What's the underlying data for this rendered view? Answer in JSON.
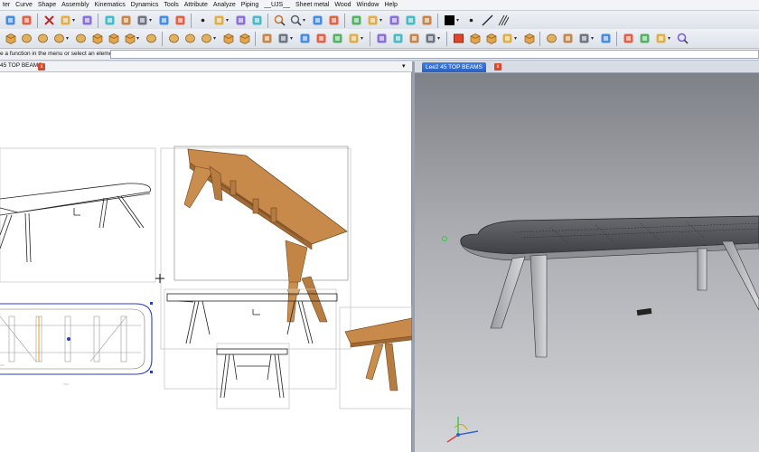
{
  "menu": [
    "ter",
    "Curve",
    "Shape",
    "Assembly",
    "Kinematics",
    "Dynamics",
    "Tools",
    "Attribute",
    "Analyze",
    "Piping",
    "__UJS__",
    "Sheet metal",
    "Wood",
    "Window",
    "Help"
  ],
  "toolbar1": {
    "icons": [
      "layers-icon",
      "print-icon",
      "delete-icon",
      "undo-icon",
      "eraser-icon",
      "refresh-icon",
      "copy-icon",
      "move-icon",
      "align-icon",
      "grid-icon",
      "pointer-icon",
      "cross-arrows-icon",
      "scissors-icon",
      "pencil-icon",
      "zoom-in-icon",
      "zoom-window-icon",
      "fit-icon",
      "pan-icon",
      "rotate-icon",
      "view-icon",
      "shade-icon",
      "render-icon",
      "light-icon",
      "color-swatch-icon",
      "point-icon",
      "line-style-icon",
      "hatch-icon"
    ]
  },
  "toolbar2": {
    "icons": [
      "box-icon",
      "cylinder-icon",
      "cone-icon",
      "sphere-icon",
      "torus-icon",
      "wedge-icon",
      "prism-icon",
      "extrude-icon",
      "revolve-icon",
      "sweep-icon",
      "loft-icon",
      "fillet-icon",
      "chamfer-icon",
      "shell-icon",
      "union-icon",
      "subtract-icon",
      "intersect-icon",
      "split-icon",
      "mirror-icon",
      "pattern-icon",
      "offset-icon",
      "draft-icon",
      "thicken-icon",
      "boolean-icon",
      "solid-red-icon",
      "solid-cube-icon",
      "sheet-icon",
      "wood-joint-icon",
      "board-icon",
      "dowel-icon",
      "view-plane-icon",
      "measure-icon",
      "section-icon",
      "assembly-icon",
      "bom-icon",
      "hand-icon",
      "info-icon"
    ]
  },
  "prompt": {
    "text": "e a function in the menu or select an element:",
    "value": ""
  },
  "left_tab": {
    "label": "45 TOP BEAMS",
    "close": "x"
  },
  "right_tab": {
    "label": "Lee2 45 TOP BEAMS",
    "close": "x"
  },
  "colors": {
    "wood": "#c78a4a",
    "wood_dark": "#8a5a2a",
    "selection": "#2b3fb8",
    "tab_active": "#2a5fbf"
  }
}
